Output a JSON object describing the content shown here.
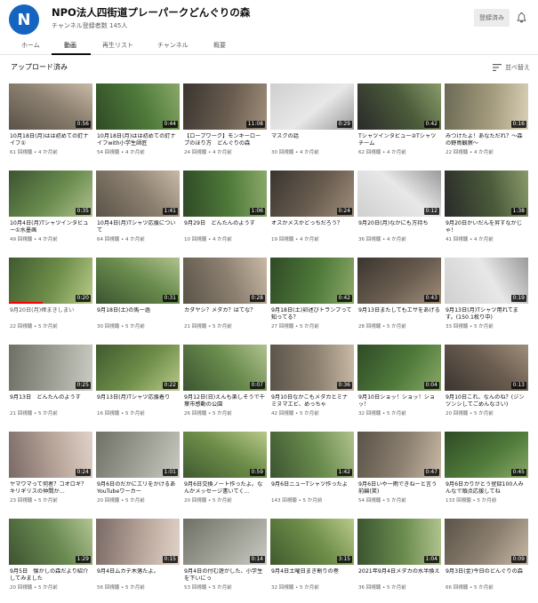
{
  "channel": {
    "avatar_letter": "N",
    "name": "NPO法人四街道プレーパークどんぐりの森",
    "subscribers": "チャンネル登録者数 145人",
    "subscribed_label": "登録済み"
  },
  "tabs": [
    "ホーム",
    "動画",
    "再生リスト",
    "チャンネル",
    "概要"
  ],
  "section": {
    "title": "アップロード済み",
    "sort_label": "並べ替え"
  },
  "colors": {
    "avatar": "#1565c0",
    "progress": "#ff0000"
  },
  "videos": [
    {
      "title": "10月18日(月)はは初めての釘ナイフ①",
      "meta": "61 回視聴 • 4 か月前",
      "duration": "0:56"
    },
    {
      "title": "10月18日(月)はは初めての釘ナイフwith小学生師匠",
      "meta": "54 回視聴 • 4 か月前",
      "duration": "0:44"
    },
    {
      "title": "【ロープワーク】モンキーロープのほり方　どんぐりの森",
      "meta": "24 回視聴 • 4 か月前",
      "duration": "11:08"
    },
    {
      "title": "マスクの話",
      "meta": "30 回視聴 • 4 か月前",
      "duration": "0:29"
    },
    {
      "title": "Tシャツインタビュー②Tシャツチーム",
      "meta": "62 回視聴 • 4 か月前",
      "duration": "0:42"
    },
    {
      "title": "みつけたよ！あなただれ？～森の野鳥観察～",
      "meta": "22 回視聴 • 4 か月前",
      "duration": "0:16"
    },
    {
      "title": "10月4日(月)Tシャツインタビュー①水墨画",
      "meta": "49 回視聴 • 4 か月前",
      "duration": "0:35"
    },
    {
      "title": "10月4日(月)Tシャツ応援について",
      "meta": "64 回視聴 • 4 か月前",
      "duration": "1:41"
    },
    {
      "title": "9月29日　どんたんのようす",
      "meta": "10 回視聴 • 4 か月前",
      "duration": "1:06"
    },
    {
      "title": "オスかメスかどっちだろう？",
      "meta": "19 回視聴 • 4 か月前",
      "duration": "0:24"
    },
    {
      "title": "9月20日(月)なかにも方持ち",
      "meta": "36 回視聴 • 4 か月前",
      "duration": "0:12"
    },
    {
      "title": "9月20日かいだんを昇すなかじゃ！",
      "meta": "41 回視聴 • 4 か月前",
      "duration": "1:38"
    },
    {
      "title": "9月20日(月)棒まきしまい",
      "meta": "22 回視聴 • 5 か月前",
      "duration": "0:20",
      "progress": 0.4
    },
    {
      "title": "9月18日(土)の馬一過",
      "meta": "30 回視聴 • 5 か月前",
      "duration": "0:31"
    },
    {
      "title": "カダヤシ？メダカ？はてな？",
      "meta": "21 回視聴 • 5 か月前",
      "duration": "0:28"
    },
    {
      "title": "9月18日(土)卯述びトランプって知ってる？",
      "meta": "27 回視聴 • 5 か月前",
      "duration": "0:42"
    },
    {
      "title": "9月13日またしてもエサをあげる",
      "meta": "28 回視聴 • 5 か月前",
      "duration": "0:43"
    },
    {
      "title": "9月13日(月)Tシャツ用れてます。(150.1枚り中)",
      "meta": "33 回視聴 • 5 か月前",
      "duration": "0:19"
    },
    {
      "title": "9月13日　どんたんのようす",
      "meta": "21 回視聴 • 5 か月前",
      "duration": "0:25"
    },
    {
      "title": "9月13日(月)Tシャツ応援着り",
      "meta": "16 回視聴 • 5 か月前",
      "duration": "0:22"
    },
    {
      "title": "9月12日(日)えんも楽しそうで千葉市感動の公園",
      "meta": "26 回視聴 • 5 か月前",
      "duration": "0:07"
    },
    {
      "title": "9月10日なかこもメダカとミナミヌマエビ、めっちゃ",
      "meta": "42 回視聴 • 5 か月前",
      "duration": "0:36"
    },
    {
      "title": "9月10日ショッ！ショッ！ショッ！",
      "meta": "32 回視聴 • 5 か月前",
      "duration": "0:04"
    },
    {
      "title": "9月10日これ、なんのね？(ジンツンシしてごめんなさい)",
      "meta": "20 回視聴 • 5 か月前",
      "duration": "0:13"
    },
    {
      "title": "ヤマワマって何者？コオロギ？キリギリスの仲間か…",
      "meta": "23 回視聴 • 5 か月前",
      "duration": "0:24"
    },
    {
      "title": "9月6日のだかにエリをかけるあYouTubeワーカー",
      "meta": "20 回視聴 • 5 か月前",
      "duration": "1:01"
    },
    {
      "title": "9月6日交換ノート作ったよ。なんかメッセージ書いてく…",
      "meta": "20 回視聴 • 5 か月前",
      "duration": "0:59"
    },
    {
      "title": "9月6日ニューTシャツ作ったよ",
      "meta": "143 回視聴 • 5 か月前",
      "duration": "1:42"
    },
    {
      "title": "9月6日いや一雨できねーと言う前編(笑)",
      "meta": "54 回視聴 • 5 か月前",
      "duration": "0:47"
    },
    {
      "title": "9月6日カりがとう登録100人みんなで頑点応援してね",
      "meta": "133 回視聴 • 5 か月前",
      "duration": "0:45"
    },
    {
      "title": "9月5日　懐かしの森だより紹介してみました",
      "meta": "20 回視聴 • 5 か月前",
      "duration": "1:29"
    },
    {
      "title": "9月4日ムカデ木落たよ。",
      "meta": "56 回視聴 • 5 か月前",
      "duration": "0:15"
    },
    {
      "title": "9月4日の付む遊がした、小学生を下いにっ",
      "meta": "53 回視聴 • 5 か月前",
      "duration": "0:14"
    },
    {
      "title": "9月4日土曜日まき割りの巻",
      "meta": "32 回視聴 • 5 か月前",
      "duration": "3:15"
    },
    {
      "title": "2021年9月4日メダカの水半換え",
      "meta": "36 回視聴 • 5 か月前",
      "duration": "1:04"
    },
    {
      "title": "9月3日(金)今日のどんぐりの森",
      "meta": "66 回視聴 • 5 か月前",
      "duration": "0:09"
    }
  ]
}
